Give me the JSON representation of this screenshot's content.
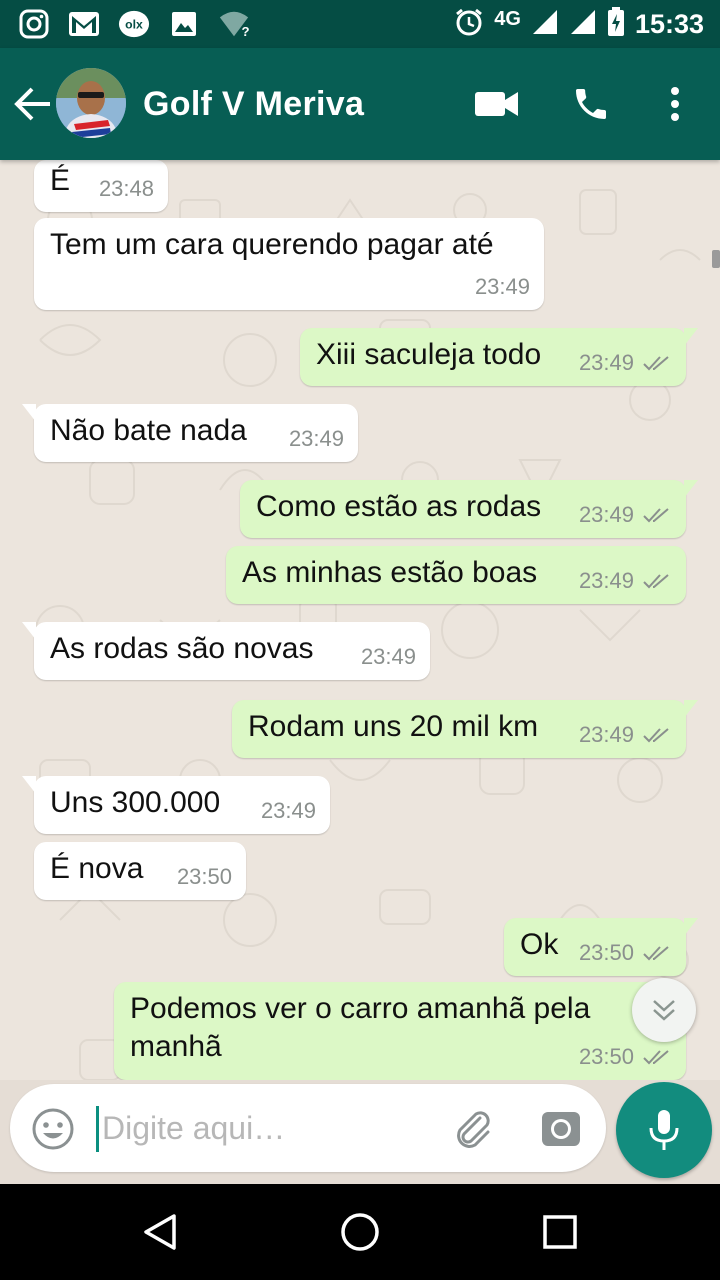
{
  "status_bar": {
    "network": "4G",
    "time": "15:33",
    "left_icons": [
      "instagram-icon",
      "gmail-icon",
      "olx-icon",
      "image-icon",
      "wifi-unknown-icon"
    ],
    "right_icons": [
      "alarm-icon",
      "signal-icon",
      "signal-icon",
      "battery-charging-icon"
    ]
  },
  "app_bar": {
    "contact_name": "Golf V Meriva",
    "actions": [
      "video-call-icon",
      "phone-icon",
      "more-vert-icon"
    ],
    "color": "#075e54"
  },
  "messages": [
    {
      "side": "in",
      "text": "É",
      "time": "23:48"
    },
    {
      "side": "in",
      "text": "Tem um  cara querendo pagar até",
      "time": "23:49"
    },
    {
      "side": "out",
      "text": "Xiii saculeja todo",
      "time": "23:49",
      "read": true
    },
    {
      "side": "in",
      "text": "Não bate nada",
      "time": "23:49"
    },
    {
      "side": "out",
      "text": "Como estão as rodas",
      "time": "23:49",
      "read": true
    },
    {
      "side": "out",
      "text": "As minhas estão boas",
      "time": "23:49",
      "read": true
    },
    {
      "side": "in",
      "text": "As rodas são novas",
      "time": "23:49"
    },
    {
      "side": "out",
      "text": "Rodam uns 20 mil km",
      "time": "23:49",
      "read": true
    },
    {
      "side": "in",
      "text": "Uns 300.000",
      "time": "23:49"
    },
    {
      "side": "in",
      "text": "É nova",
      "time": "23:50"
    },
    {
      "side": "out",
      "text": "Ok",
      "time": "23:50",
      "read": true
    },
    {
      "side": "out",
      "text": "Podemos ver o carro amanhã pela manhã",
      "time": "23:50",
      "read": true
    }
  ],
  "composer": {
    "placeholder": "Digite aqui…",
    "value": ""
  },
  "colors": {
    "incoming_bubble": "#ffffff",
    "outgoing_bubble": "#dcf8c6",
    "accent": "#128c7e"
  }
}
